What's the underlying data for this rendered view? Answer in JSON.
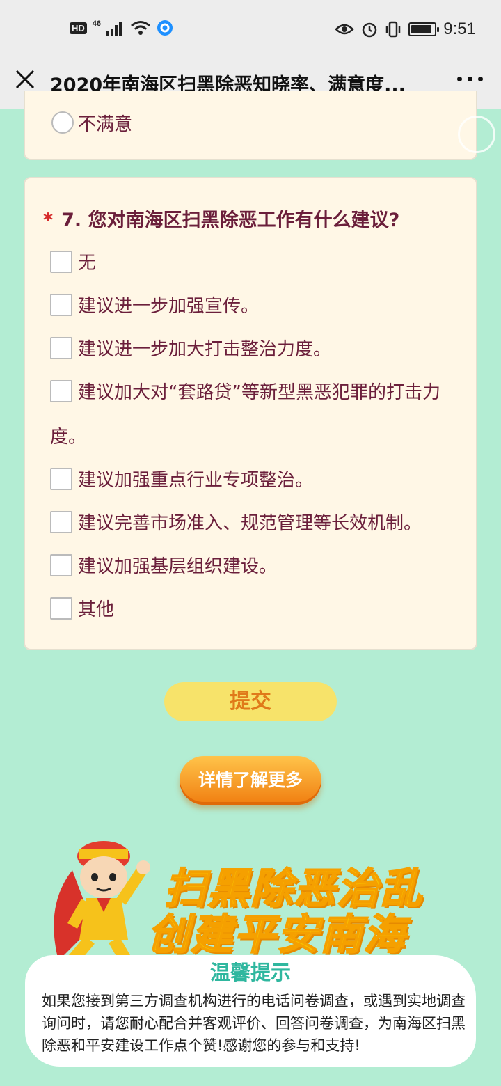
{
  "status": {
    "hd": "HD",
    "signal": "46",
    "time": "9:51",
    "battery_level": 0.9
  },
  "nav": {
    "title": "2020年南海区扫黑除恶知晓率、满意度..."
  },
  "prev_question": {
    "option": "不满意"
  },
  "question7": {
    "required_mark": "*",
    "title": "7. 您对南海区扫黑除恶工作有什么建议?",
    "options": [
      "无",
      "建议进一步加强宣传。",
      "建议进一步加大打击整治力度。",
      "建议加大对“套路贷”等新型黑恶犯罪的打击力度。",
      "建议加强重点行业专项整治。",
      "建议完善市场准入、规范管理等长效机制。",
      "建议加强基层组织建设。",
      "其他"
    ]
  },
  "submit_label": "提交",
  "more_label": "详情了解更多",
  "banner": {
    "line1": "扫黑除恶治乱",
    "line2": "创建平安南海"
  },
  "tip": {
    "title": "温馨提示",
    "body": "如果您接到第三方调查机构进行的电话问卷调查，或遇到实地调查询问时，请您耐心配合并客观评价、回答问卷调查，为南海区扫黑除恶和平安建设工作点个赞!感谢您的参与和支持!"
  },
  "colors": {
    "background": "#b3edd3",
    "card": "#fff7e6",
    "text": "#6b1f3b",
    "required": "#d62b2b",
    "submit_bg": "#f7e36a",
    "banner_yellow": "#f7c200",
    "tip_title": "#2fb79f"
  },
  "icons": {
    "close": "close-icon",
    "more": "more-icon",
    "wifi": "wifi-icon",
    "eye": "eye-icon",
    "alarm": "alarm-icon",
    "vibrate": "vibrate-icon"
  }
}
